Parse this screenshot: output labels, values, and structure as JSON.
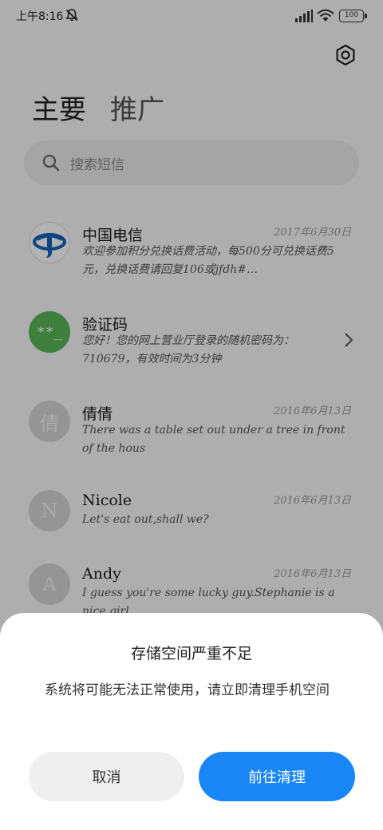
{
  "status_bar": {
    "time": "上午8:16",
    "battery": "100",
    "icons": [
      "mute-icon",
      "signal-icon",
      "wifi-icon",
      "battery-icon"
    ]
  },
  "header": {
    "settings_icon": "gear-icon",
    "tabs": [
      {
        "label": "主要"
      },
      {
        "label": "推广"
      }
    ]
  },
  "search": {
    "placeholder": "搜索短信",
    "icon": "search-icon"
  },
  "messages": [
    {
      "name": "中国电信",
      "date": "2017年6月30日",
      "preview": "欢迎参加积分兑换话费活动，每500分可兑换话费5元，兑换话费请回复106或jfdh#…",
      "avatar": "china-telecom-logo"
    },
    {
      "name": "验证码",
      "date": "",
      "preview": "您好！您的网上营业厅登录的随机密码为：710679，有效时间为3分钟",
      "avatar_text": "**_",
      "avatar_color": "#5ab65a"
    },
    {
      "name": "倩倩",
      "date": "2016年6月13日",
      "preview": "There was a table set out under a tree in front of the hous",
      "avatar_text": "倩"
    },
    {
      "name": "Nicole",
      "date": "2016年6月13日",
      "preview": "Let's eat out,shall we?",
      "avatar_text": "N"
    },
    {
      "name": "Andy",
      "date": "2016年6月13日",
      "preview": "I guess you're some lucky guy.Stephanie is a nice girl",
      "avatar_text": "A"
    }
  ],
  "dialog": {
    "title": "存储空间严重不足",
    "body": "系统将可能无法正常使用，请立即清理手机空间",
    "cancel_label": "取消",
    "confirm_label": "前往清理"
  },
  "colors": {
    "accent": "#1a86f5",
    "cancel_bg": "#efefef",
    "search_bg": "#ececec"
  }
}
